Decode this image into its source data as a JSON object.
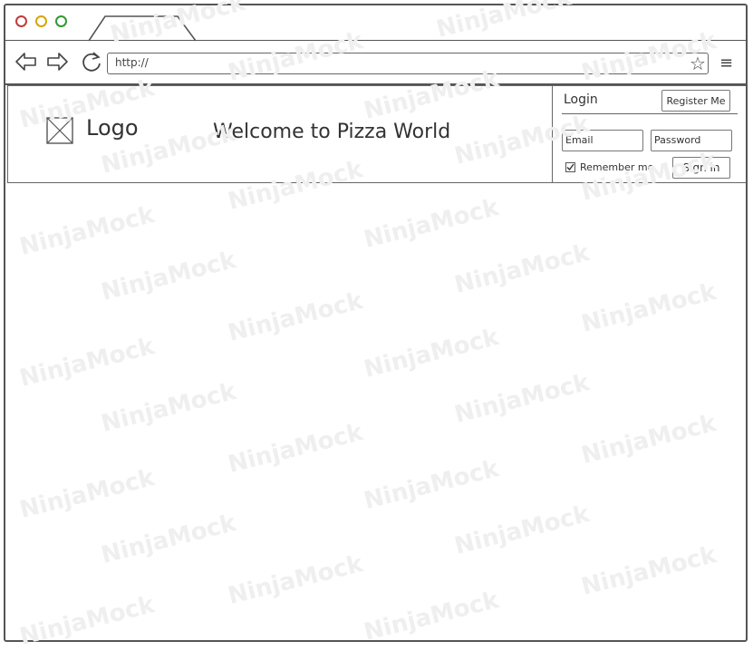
{
  "watermark": "NinjaMock",
  "browser": {
    "url": "http://",
    "icons": {
      "back": "back-arrow-icon",
      "forward": "forward-arrow-icon",
      "reload": "reload-icon",
      "bookmark": "star-icon",
      "menu": "hamburger-menu-icon"
    },
    "window_colors": {
      "close": "#c23b3b",
      "minimize": "#d9a400",
      "maximize": "#2f9a2f"
    }
  },
  "header": {
    "logo_label": "Logo",
    "welcome": "Welcome to Pizza World"
  },
  "login": {
    "title": "Login",
    "register_label": "Register Me",
    "email_placeholder": "Email",
    "password_placeholder": "Password",
    "remember_label": "Remember me",
    "remember_checked": true,
    "signin_label": "Sign in"
  }
}
